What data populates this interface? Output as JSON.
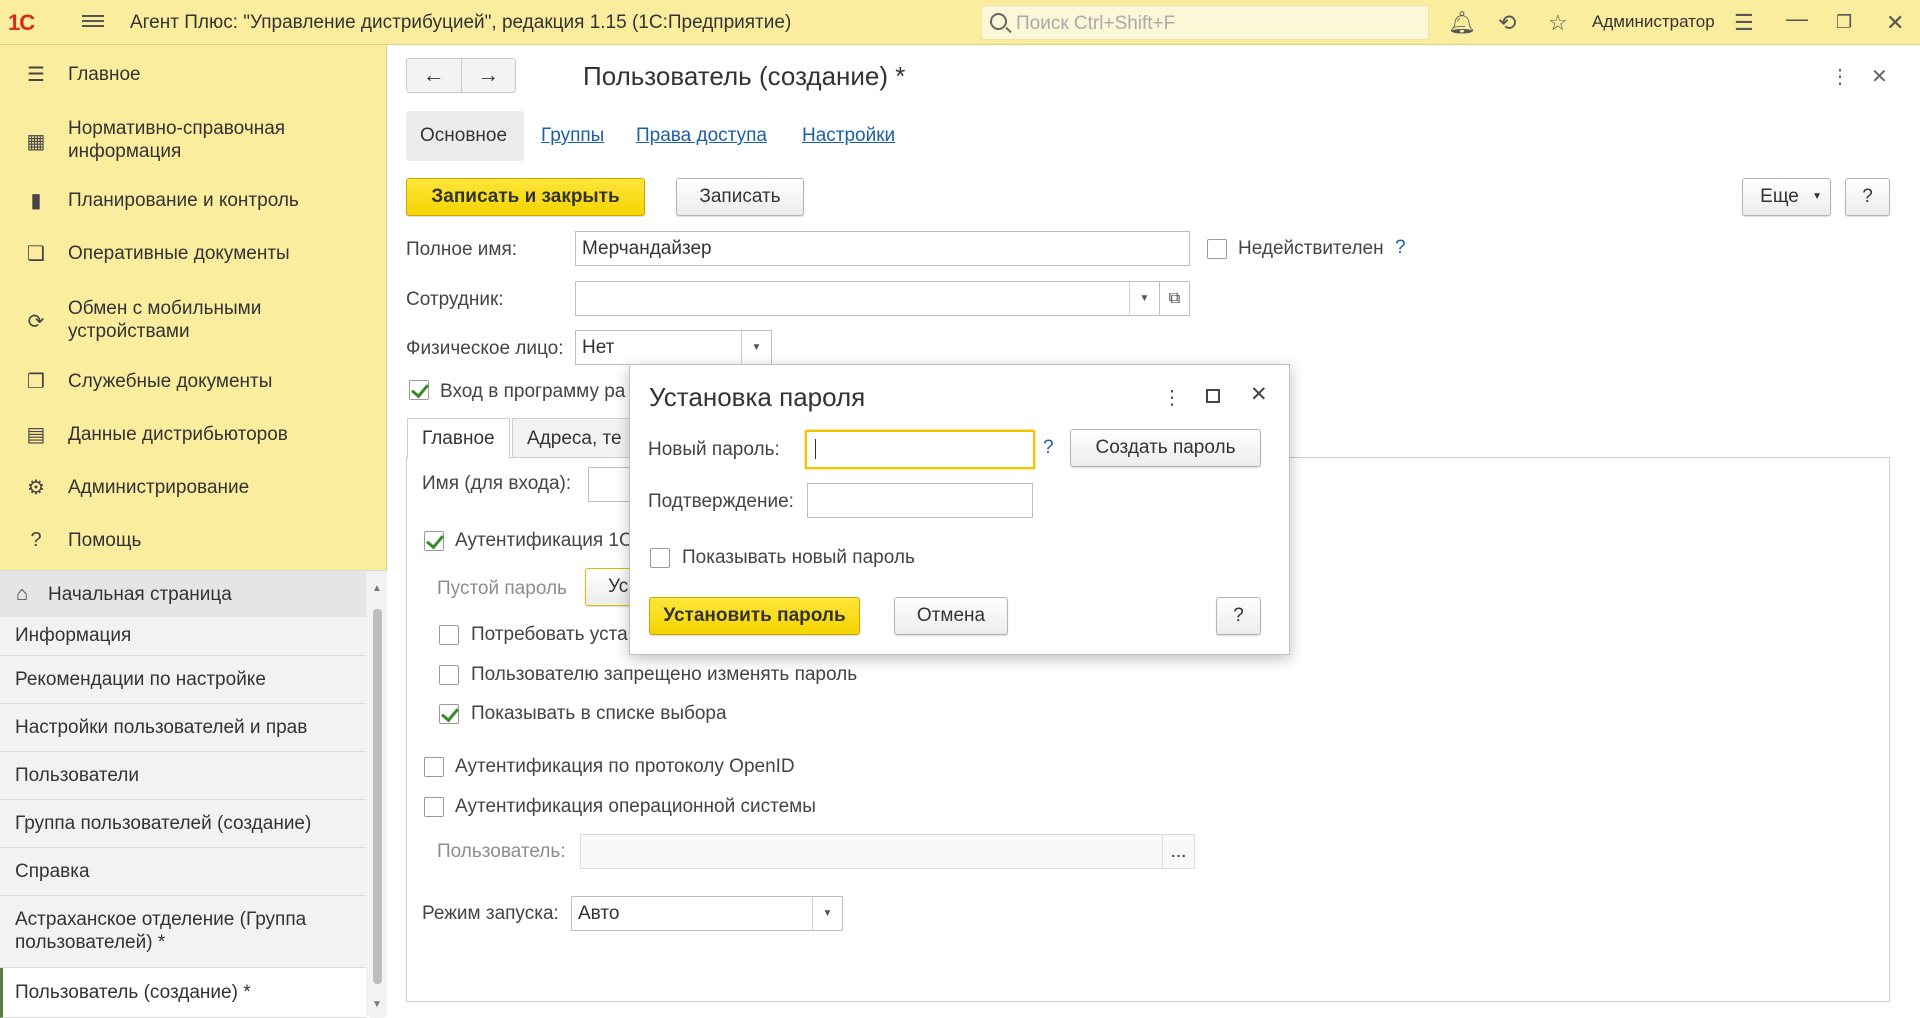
{
  "topbar": {
    "logo": "1С",
    "title": "Агент Плюс: \"Управление дистрибуцией\", редакция 1.15  (1С:Предприятие)",
    "search_placeholder": "Поиск Ctrl+Shift+F",
    "user": "Администратор"
  },
  "sidebar": {
    "items": [
      {
        "label": "Главное",
        "icon": "list-icon"
      },
      {
        "label": "Нормативно-справочная информация",
        "icon": "catalog-icon"
      },
      {
        "label": "Планирование и контроль",
        "icon": "chart-icon"
      },
      {
        "label": "Оперативные документы",
        "icon": "documents-icon"
      },
      {
        "label": "Обмен с мобильными устройствами",
        "icon": "sync-icon"
      },
      {
        "label": "Служебные документы",
        "icon": "service-docs-icon"
      },
      {
        "label": "Данные дистрибьюторов",
        "icon": "distributor-icon"
      },
      {
        "label": "Администрирование",
        "icon": "gear-icon"
      },
      {
        "label": "Помощь",
        "icon": "question-icon"
      }
    ],
    "home_label": "Начальная страница",
    "open_windows": [
      "Информация",
      "Рекомендации по настройке",
      "Настройки пользователей и прав",
      "Пользователи",
      "Группа пользователей (создание)",
      "Справка",
      "Астраханское отделение (Группа пользователей) *",
      "Пользователь (создание) *"
    ]
  },
  "form": {
    "title": "Пользователь (создание) *",
    "tabs": [
      "Основное",
      "Группы",
      "Права доступа",
      "Настройки"
    ],
    "save_close": "Записать и закрыть",
    "save": "Записать",
    "more": "Еще",
    "help": "?",
    "full_name_label": "Полное имя:",
    "full_name_value": "Мерчандайзер",
    "inactive_label": "Недействителен",
    "employee_label": "Сотрудник:",
    "employee_value": "",
    "person_label": "Физическое лицо:",
    "person_value": "Нет",
    "login_allowed_label": "Вход в программу ра",
    "inner_tabs": [
      "Главное",
      "Адреса, те"
    ],
    "login_name_label": "Имя (для входа):",
    "auth_1c_label": "Аутентификация 1С",
    "empty_password_label": "Пустой пароль",
    "set_btn_partial": "Ус",
    "require_change_label": "Потребовать уста",
    "forbid_change_label": "Пользователю запрещено изменять пароль",
    "show_in_list_label": "Показывать в списке выбора",
    "openid_label": "Аутентификация по протоколу OpenID",
    "os_auth_label": "Аутентификация операционной системы",
    "os_user_label": "Пользователь:",
    "os_user_btn": "...",
    "run_mode_label": "Режим запуска:",
    "run_mode_value": "Авто"
  },
  "dialog": {
    "title": "Установка пароля",
    "new_password_label": "Новый пароль:",
    "confirm_label": "Подтверждение:",
    "generate_btn": "Создать пароль",
    "show_password_label": "Показывать новый пароль",
    "set_btn": "Установить пароль",
    "cancel_btn": "Отмена",
    "help_btn": "?",
    "help_link": "?"
  }
}
